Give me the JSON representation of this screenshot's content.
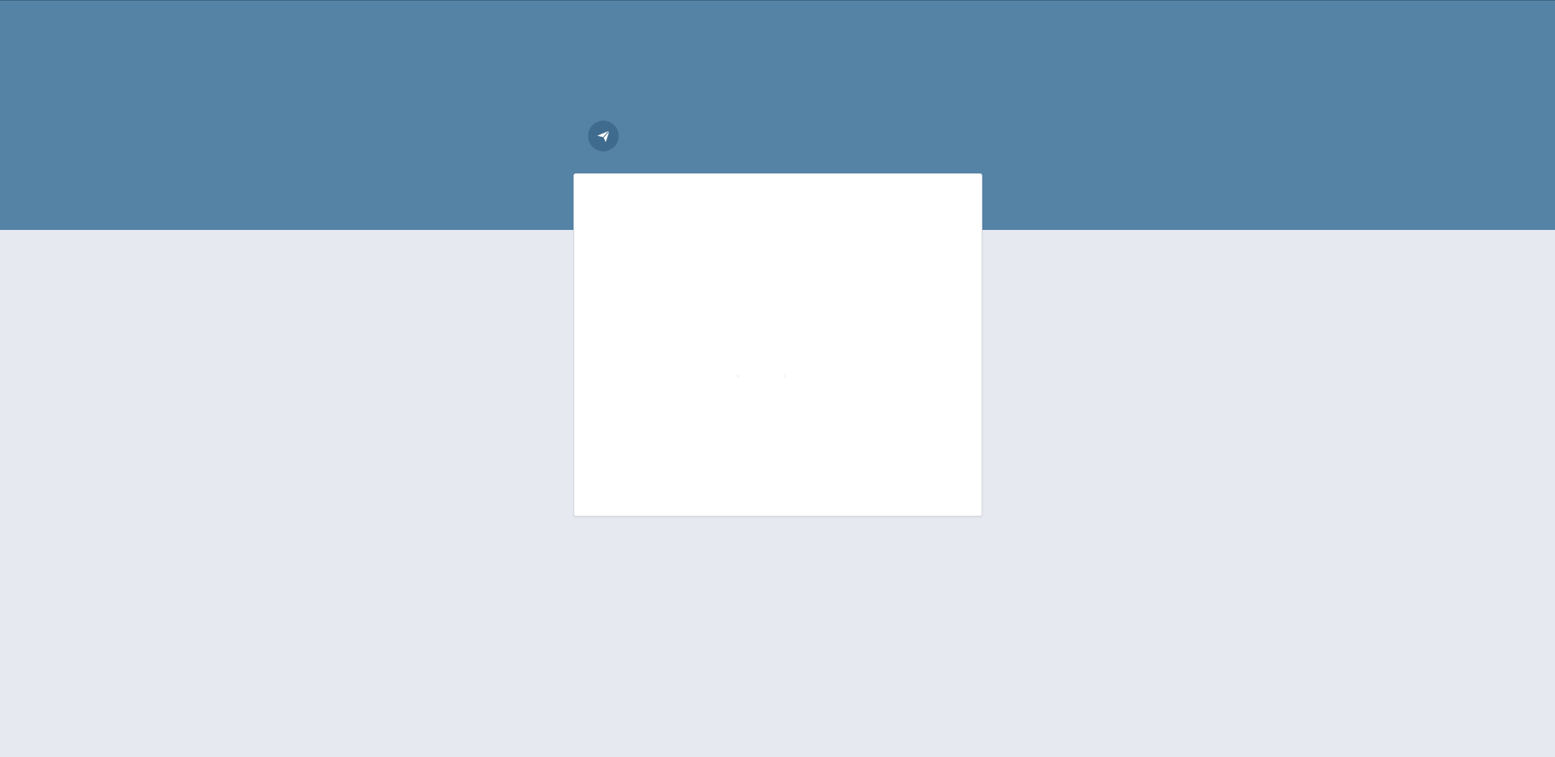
{
  "colors": {
    "header_background": "#5483a6",
    "page_background": "#e6e9ef",
    "logo_background": "#3f6b8e",
    "card_background": "#ffffff"
  },
  "logo": {
    "icon": "paper-plane-icon"
  },
  "card": {
    "state": "loading"
  }
}
